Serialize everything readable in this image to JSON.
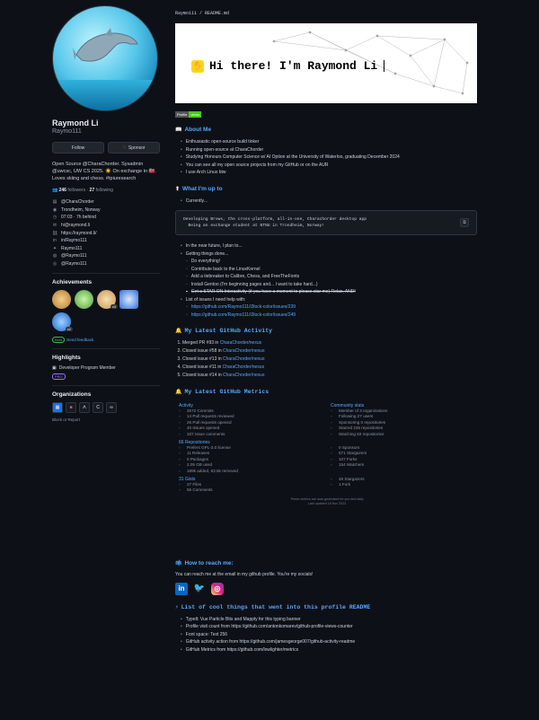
{
  "profile": {
    "name": "Raymond Li",
    "username": "Raymo111",
    "follow_label": "Follow",
    "sponsor_label": "Sponsor",
    "bio": "Open Source @CharaChorder. Sysadmin @uwcsc, UW CS 2025. ☀️ On exchange in 🇳🇴. Loves skiing and chess. #tpiuresearch",
    "followers_count": "246",
    "followers_label": "followers",
    "following_count": "27",
    "following_label": "following",
    "details": [
      {
        "icon": "org-icon",
        "text": "@CharaChorder"
      },
      {
        "icon": "location-icon",
        "text": "Trondheim, Norway"
      },
      {
        "icon": "clock-icon",
        "text": "07:03 · 7h behind"
      },
      {
        "icon": "mail-icon",
        "text": "hi@raymond.li"
      },
      {
        "icon": "link-icon",
        "text": "https://raymond.li/"
      },
      {
        "icon": "linkedin-icon",
        "text": "in/Raymo111"
      },
      {
        "icon": "twitter-icon",
        "text": "Raymo111"
      },
      {
        "icon": "mastodon-icon",
        "text": "@Raymo111"
      },
      {
        "icon": "instagram-icon",
        "text": "@Raymo111"
      }
    ],
    "achievements_heading": "Achievements",
    "achievement_counts": [
      "x3",
      "x2"
    ],
    "beta_label": "Beta",
    "send_feedback": "Send feedback",
    "highlights_heading": "Highlights",
    "highlight_text": "Developer Program Member",
    "pro_label": "PRO",
    "organizations_heading": "Organizations",
    "block_report": "Block or Report"
  },
  "readme": {
    "file_path": "Raymo111 / README.md",
    "banner_text": "Hi there! I'm Raymond Li",
    "views_label": "Profile",
    "views_value": "views",
    "about_heading": "About Me",
    "about_items": [
      "Enthusiastic open-source build tinker",
      "Running  open-source  at  CharaChorder",
      "Studying Honours Computer Science w/ AI Option at the University of Waterloo, graduating December 2024",
      "You can see all my open source projects from my GitHub or on the AUR",
      "I use Arch Linux btw"
    ],
    "upto_heading": "What I'm up to",
    "upto_intro": "Currently...",
    "code_block": "Developing Brows, the cross-platform, all-in-one, Charachorder desktop app\n  Being an exchange student at NTNU in Trondheim, Norway!",
    "upto_items": [
      "In the near future, I plan to...",
      "Getting things done..."
    ],
    "upto_sub_items": [
      "Do everything!",
      "Contribute back to the LinuxKernel",
      "Add a tiebreaker to Calibre, Chess, and FreeTheFonts",
      "Install Gentoo (I'm beginning pages and... I want to take hard...)",
      "Get a STAR ON Interactivity (if you have a moment to please star me) Relax, AND!"
    ],
    "learning_item": "List of issues I need help with:",
    "learning_links": [
      "https://github.com/Raymo111/i3lock-color/issues/239",
      "https://github.com/Raymo111/i3lock-color/issues/249"
    ],
    "activity_heading": "My Latest GitHub Activity",
    "activity_items": [
      {
        "text": "Merged PR #93 in ",
        "link": "CharaChorder/nexus"
      },
      {
        "text": "Closed issue #58 in ",
        "link": "CharaChorder/nexus"
      },
      {
        "text": "Closed issue #13 in ",
        "link": "CharaChorder/nexus"
      },
      {
        "text": "Closed issue #11 in ",
        "link": "CharaChorder/nexus"
      },
      {
        "text": "Closed issue #14 in ",
        "link": "CharaChorder/nexus"
      }
    ],
    "metrics_heading": "My Latest GitHub Metrics",
    "metrics_left": {
      "activity_title": "Activity",
      "activity": [
        "2572 Commits",
        "14 Pull requests reviewed",
        "26 Pull requests opened",
        "40 Issues opened",
        "337 Issue comments"
      ],
      "repos_title": "66 Repositories",
      "repos": [
        "Prefers GPL-3.0 license",
        "11 Releases",
        "0 Packages",
        "2.05 GB used",
        "189k added, 63.5k removed"
      ],
      "gists_title": "31 Gists",
      "gists": [
        "27 Files",
        "55 Comments"
      ]
    },
    "metrics_right": {
      "community_title": "Community stats",
      "community": [
        "Member of 3 organizations",
        "Following 27 users",
        "Sponsoring 0 repositories",
        "Starred 235 repositories",
        "Watching 83 repositories"
      ],
      "repo_stats": [
        "0 Sponsors",
        "571 Stargazers",
        "107 Forks",
        "154 Watchers"
      ],
      "gist_stats": [
        "48 Stargazers",
        "1 Fork"
      ]
    },
    "metrics_footer": "These metrics are auto-generated for you and daily\nLast updated 18 Nov 2023",
    "reach_heading": "How to reach me:",
    "reach_text": "You can reach me at the email in my github profile. You're my socials!",
    "tools_heading": "List of cool things that went into this profile README",
    "tools_items": [
      "Typelt: Vue Particle Bits and Mapply for this typing banner",
      "Profile visit count from https://github.com/antonkomarev/github-profile-views-counter",
      "Font space: Text 256",
      "GitHub activity action from https://github.com/jamesgeorge007/github-activity-readme",
      "GitHub Metrics from https://github.com/lowlighter/metrics"
    ]
  },
  "colors": {
    "bg": "#0d1117",
    "link": "#58a6ff",
    "views_green": "#44cc11",
    "linkedin": "#0a66c2",
    "twitter": "#1d9bf0",
    "instagram": "#dd2a7b"
  }
}
